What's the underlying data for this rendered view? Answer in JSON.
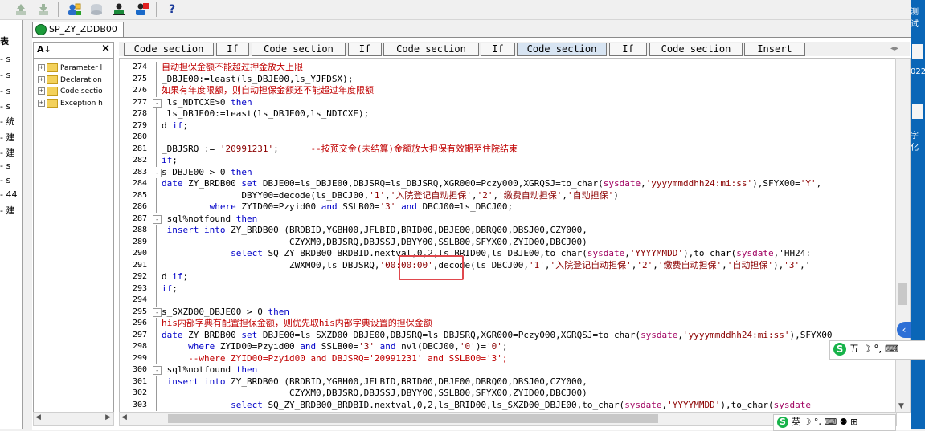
{
  "toolbar": {
    "icons": [
      "add-icon",
      "remove-icon",
      "users-add-icon",
      "drive-icon",
      "users-icon",
      "users-remove-icon",
      "help-icon"
    ],
    "help_label": "?"
  },
  "left_strip": {
    "header": "表",
    "items": [
      "- s",
      "- s",
      "- s",
      "- s",
      "- 统",
      "- 建",
      "- 建",
      "- s",
      "- s",
      "- 44",
      "- 建"
    ]
  },
  "window_tab": {
    "title": "SP_ZY_ZDDB00"
  },
  "tree": {
    "sort_label": "A↓",
    "close_label": "×",
    "items": [
      "Parameter l",
      "Declaration",
      "Code sectio",
      "Exception h"
    ]
  },
  "tabs": [
    {
      "label": "Code section",
      "active": false
    },
    {
      "label": "If",
      "active": false
    },
    {
      "label": "Code section",
      "active": false
    },
    {
      "label": "If",
      "active": false
    },
    {
      "label": "Code section",
      "active": false
    },
    {
      "label": "If",
      "active": false
    },
    {
      "label": "Code section",
      "active": true
    },
    {
      "label": "If",
      "active": false
    },
    {
      "label": "Code section",
      "active": false
    },
    {
      "label": "Insert",
      "active": false
    }
  ],
  "tabs_nav": "◂▸",
  "editor": {
    "lines": [
      {
        "n": "274",
        "fold": "",
        "t": "自动担保金额不能超过押金放大上限"
      },
      {
        "n": "275",
        "fold": "",
        "t": "_DBJE00:=least(ls_DBJE00,ls_YJFDSX);"
      },
      {
        "n": "276",
        "fold": "",
        "t": "如果有年度限额，则自动担保金额还不能超过年度限额"
      },
      {
        "n": "277",
        "fold": "-",
        "t": " ls_NDTCXE>0 then"
      },
      {
        "n": "278",
        "fold": "",
        "t": " ls_DBJE00:=least(ls_DBJE00,ls_NDTCXE);"
      },
      {
        "n": "279",
        "fold": "",
        "t": "d if;"
      },
      {
        "n": "280",
        "fold": "",
        "t": ""
      },
      {
        "n": "281",
        "fold": "",
        "t": "_DBJSRQ := '20991231';      --按预交金(未结算)金额放大担保有效期至住院结束"
      },
      {
        "n": "282",
        "fold": "",
        "t": "if;"
      },
      {
        "n": "283",
        "fold": "-",
        "t": "s_DBJE00 > 0 then"
      },
      {
        "n": "284",
        "fold": "",
        "t": "date ZY_BRDB00 set DBJE00=ls_DBJE00,DBJSRQ=ls_DBJSRQ,XGR000=Pczy000,XGRQSJ=to_char(sysdate,'yyyymmddhh24:mi:ss'),SFYX00='Y',"
      },
      {
        "n": "285",
        "fold": "",
        "t": "               DBYY00=decode(ls_DBCJ00,'1','入院登记自动担保','2','缴费自动担保','自动担保')"
      },
      {
        "n": "286",
        "fold": "",
        "t": "         where ZYID00=Pzyid00 and SSLB00='3' and DBCJ00=ls_DBCJ00;"
      },
      {
        "n": "287",
        "fold": "-",
        "t": " sql%notfound then"
      },
      {
        "n": "288",
        "fold": "",
        "t": " insert into ZY_BRDB00 (BRDBID,YGBH00,JFLBID,BRID00,DBJE00,DBRQ00,DBSJ00,CZY000,"
      },
      {
        "n": "289",
        "fold": "",
        "t": "                        CZYXM0,DBJSRQ,DBJSSJ,DBYY00,SSLB00,SFYX00,ZYID00,DBCJ00)"
      },
      {
        "n": "290",
        "fold": "",
        "t": "             select SQ_ZY_BRDB00_BRDBID.nextval,0,2,ls_BRID00,ls_DBJE00,to_char(sysdate,'YYYYMMDD'),to_char(sysdate,'HH24:"
      },
      {
        "n": "291",
        "fold": "",
        "t": "                        ZWXM00,ls_DBJSRQ,'00:00:00',decode(ls_DBCJ00,'1','入院登记自动担保','2','缴费自动担保','自动担保'),'3','"
      },
      {
        "n": "292",
        "fold": "",
        "t": "d if;"
      },
      {
        "n": "293",
        "fold": "",
        "t": "if;"
      },
      {
        "n": "294",
        "fold": "",
        "t": ""
      },
      {
        "n": "295",
        "fold": "-",
        "t": "s_SXZD00_DBJE00 > 0 then"
      },
      {
        "n": "296",
        "fold": "",
        "t": "his内部字典有配置担保金额，则优先取his内部字典设置的担保金额"
      },
      {
        "n": "297",
        "fold": "",
        "t": "date ZY_BRDB00 set DBJE00=ls_SXZD00_DBJE00,DBJSRQ=ls_DBJSRQ,XGR000=Pczy000,XGRQSJ=to_char(sysdate,'yyyymmddhh24:mi:ss'),SFYX00"
      },
      {
        "n": "298",
        "fold": "",
        "t": "     where ZYID00=Pzyid00 and SSLB00='3' and nvl(DBCJ00,'0')='0';"
      },
      {
        "n": "299",
        "fold": "",
        "t": "     --where ZYID00=Pzyid00 and DBJSRQ='20991231' and SSLB00='3';"
      },
      {
        "n": "300",
        "fold": "-",
        "t": " sql%notfound then"
      },
      {
        "n": "301",
        "fold": "",
        "t": " insert into ZY_BRDB00 (BRDBID,YGBH00,JFLBID,BRID00,DBJE00,DBRQ00,DBSJ00,CZY000,"
      },
      {
        "n": "302",
        "fold": "",
        "t": "                        CZYXM0,DBJSRQ,DBJSSJ,DBYY00,SSLB00,SFYX00,ZYID00,DBCJ00)"
      },
      {
        "n": "303",
        "fold": "",
        "t": "             select SQ_ZY_BRDB00_BRDBID.nextval,0,2,ls_BRID00,ls_SXZD00_DBJE00,to_char(sysdate,'YYYYMMDD'),to_char(sysdate"
      }
    ]
  },
  "desktop": {
    "labels": [
      "测试",
      "022",
      "字化"
    ]
  },
  "ime1": {
    "logo": "S",
    "text": "五 ☽ °, ⌨"
  },
  "ime2": {
    "logo": "S",
    "text": "英 ☽ °, ⌨ ⚉ ⊞"
  },
  "colors": {
    "keyword": "#0000c8",
    "string": "#8b0000",
    "comment": "#c00000",
    "highlight": "#e0484d",
    "active_tab": "#d7e4f2"
  }
}
